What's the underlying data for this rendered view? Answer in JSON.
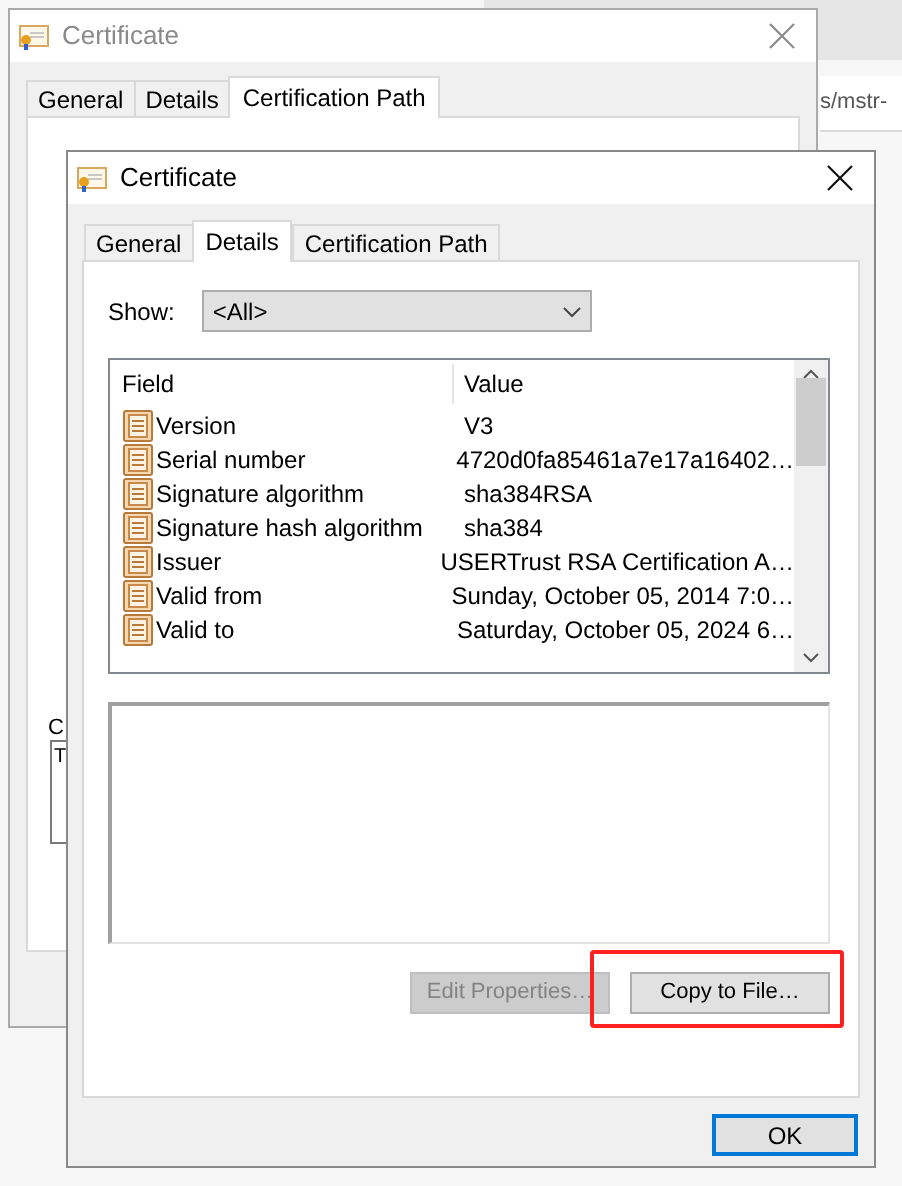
{
  "background": {
    "url_fragment": "s/mstr-"
  },
  "back_window": {
    "title": "Certificate",
    "tabs": [
      {
        "label": "General",
        "selected": false
      },
      {
        "label": "Details",
        "selected": false
      },
      {
        "label": "Certification Path",
        "selected": true
      }
    ],
    "label_fragment": "C",
    "list_fragment": "T"
  },
  "window": {
    "title": "Certificate",
    "tabs": [
      {
        "label": "General",
        "selected": false
      },
      {
        "label": "Details",
        "selected": true
      },
      {
        "label": "Certification Path",
        "selected": false
      }
    ],
    "show": {
      "label": "Show:",
      "value": "<All>"
    },
    "table": {
      "columns": [
        "Field",
        "Value"
      ],
      "rows": [
        {
          "field": "Version",
          "value": "V3"
        },
        {
          "field": "Serial number",
          "value": "4720d0fa85461a7e17a16402…"
        },
        {
          "field": "Signature algorithm",
          "value": "sha384RSA"
        },
        {
          "field": "Signature hash algorithm",
          "value": "sha384"
        },
        {
          "field": "Issuer",
          "value": "USERTrust RSA Certification A…"
        },
        {
          "field": "Valid from",
          "value": "Sunday, October 05, 2014 7:0…"
        },
        {
          "field": "Valid to",
          "value": "Saturday, October 05, 2024 6…"
        }
      ]
    },
    "buttons": [
      {
        "label": "Edit Properties…",
        "disabled": true,
        "highlighted": false
      },
      {
        "label": "Copy to File…",
        "disabled": false,
        "highlighted": true
      }
    ],
    "ok": {
      "label": "OK",
      "default": true
    }
  }
}
